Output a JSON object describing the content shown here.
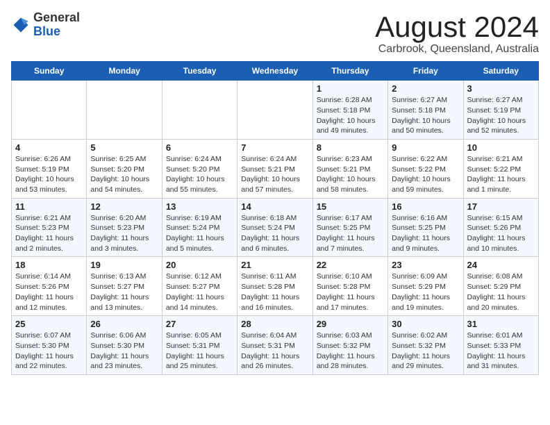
{
  "header": {
    "logo_general": "General",
    "logo_blue": "Blue",
    "month_title": "August 2024",
    "location": "Carbrook, Queensland, Australia"
  },
  "weekdays": [
    "Sunday",
    "Monday",
    "Tuesday",
    "Wednesday",
    "Thursday",
    "Friday",
    "Saturday"
  ],
  "weeks": [
    [
      {
        "day": "",
        "info": ""
      },
      {
        "day": "",
        "info": ""
      },
      {
        "day": "",
        "info": ""
      },
      {
        "day": "",
        "info": ""
      },
      {
        "day": "1",
        "info": "Sunrise: 6:28 AM\nSunset: 5:18 PM\nDaylight: 10 hours\nand 49 minutes."
      },
      {
        "day": "2",
        "info": "Sunrise: 6:27 AM\nSunset: 5:18 PM\nDaylight: 10 hours\nand 50 minutes."
      },
      {
        "day": "3",
        "info": "Sunrise: 6:27 AM\nSunset: 5:19 PM\nDaylight: 10 hours\nand 52 minutes."
      }
    ],
    [
      {
        "day": "4",
        "info": "Sunrise: 6:26 AM\nSunset: 5:19 PM\nDaylight: 10 hours\nand 53 minutes."
      },
      {
        "day": "5",
        "info": "Sunrise: 6:25 AM\nSunset: 5:20 PM\nDaylight: 10 hours\nand 54 minutes."
      },
      {
        "day": "6",
        "info": "Sunrise: 6:24 AM\nSunset: 5:20 PM\nDaylight: 10 hours\nand 55 minutes."
      },
      {
        "day": "7",
        "info": "Sunrise: 6:24 AM\nSunset: 5:21 PM\nDaylight: 10 hours\nand 57 minutes."
      },
      {
        "day": "8",
        "info": "Sunrise: 6:23 AM\nSunset: 5:21 PM\nDaylight: 10 hours\nand 58 minutes."
      },
      {
        "day": "9",
        "info": "Sunrise: 6:22 AM\nSunset: 5:22 PM\nDaylight: 10 hours\nand 59 minutes."
      },
      {
        "day": "10",
        "info": "Sunrise: 6:21 AM\nSunset: 5:22 PM\nDaylight: 11 hours\nand 1 minute."
      }
    ],
    [
      {
        "day": "11",
        "info": "Sunrise: 6:21 AM\nSunset: 5:23 PM\nDaylight: 11 hours\nand 2 minutes."
      },
      {
        "day": "12",
        "info": "Sunrise: 6:20 AM\nSunset: 5:23 PM\nDaylight: 11 hours\nand 3 minutes."
      },
      {
        "day": "13",
        "info": "Sunrise: 6:19 AM\nSunset: 5:24 PM\nDaylight: 11 hours\nand 5 minutes."
      },
      {
        "day": "14",
        "info": "Sunrise: 6:18 AM\nSunset: 5:24 PM\nDaylight: 11 hours\nand 6 minutes."
      },
      {
        "day": "15",
        "info": "Sunrise: 6:17 AM\nSunset: 5:25 PM\nDaylight: 11 hours\nand 7 minutes."
      },
      {
        "day": "16",
        "info": "Sunrise: 6:16 AM\nSunset: 5:25 PM\nDaylight: 11 hours\nand 9 minutes."
      },
      {
        "day": "17",
        "info": "Sunrise: 6:15 AM\nSunset: 5:26 PM\nDaylight: 11 hours\nand 10 minutes."
      }
    ],
    [
      {
        "day": "18",
        "info": "Sunrise: 6:14 AM\nSunset: 5:26 PM\nDaylight: 11 hours\nand 12 minutes."
      },
      {
        "day": "19",
        "info": "Sunrise: 6:13 AM\nSunset: 5:27 PM\nDaylight: 11 hours\nand 13 minutes."
      },
      {
        "day": "20",
        "info": "Sunrise: 6:12 AM\nSunset: 5:27 PM\nDaylight: 11 hours\nand 14 minutes."
      },
      {
        "day": "21",
        "info": "Sunrise: 6:11 AM\nSunset: 5:28 PM\nDaylight: 11 hours\nand 16 minutes."
      },
      {
        "day": "22",
        "info": "Sunrise: 6:10 AM\nSunset: 5:28 PM\nDaylight: 11 hours\nand 17 minutes."
      },
      {
        "day": "23",
        "info": "Sunrise: 6:09 AM\nSunset: 5:29 PM\nDaylight: 11 hours\nand 19 minutes."
      },
      {
        "day": "24",
        "info": "Sunrise: 6:08 AM\nSunset: 5:29 PM\nDaylight: 11 hours\nand 20 minutes."
      }
    ],
    [
      {
        "day": "25",
        "info": "Sunrise: 6:07 AM\nSunset: 5:30 PM\nDaylight: 11 hours\nand 22 minutes."
      },
      {
        "day": "26",
        "info": "Sunrise: 6:06 AM\nSunset: 5:30 PM\nDaylight: 11 hours\nand 23 minutes."
      },
      {
        "day": "27",
        "info": "Sunrise: 6:05 AM\nSunset: 5:31 PM\nDaylight: 11 hours\nand 25 minutes."
      },
      {
        "day": "28",
        "info": "Sunrise: 6:04 AM\nSunset: 5:31 PM\nDaylight: 11 hours\nand 26 minutes."
      },
      {
        "day": "29",
        "info": "Sunrise: 6:03 AM\nSunset: 5:32 PM\nDaylight: 11 hours\nand 28 minutes."
      },
      {
        "day": "30",
        "info": "Sunrise: 6:02 AM\nSunset: 5:32 PM\nDaylight: 11 hours\nand 29 minutes."
      },
      {
        "day": "31",
        "info": "Sunrise: 6:01 AM\nSunset: 5:33 PM\nDaylight: 11 hours\nand 31 minutes."
      }
    ]
  ]
}
